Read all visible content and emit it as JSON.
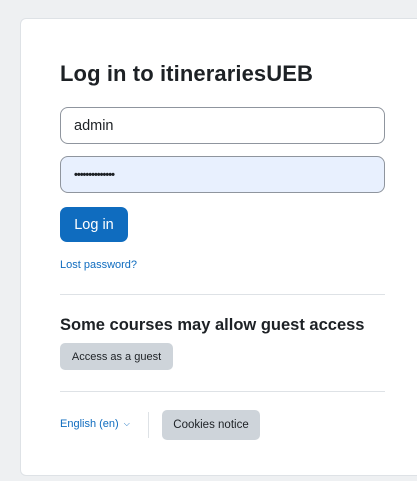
{
  "login": {
    "title": "Log in to itinerariesUEB",
    "username_value": "admin",
    "password_value": "••••••••••••••",
    "login_label": "Log in",
    "lost_password_label": "Lost password?"
  },
  "guest": {
    "heading": "Some courses may allow guest access",
    "button_label": "Access as a guest"
  },
  "footer": {
    "language_label": "English (en)",
    "language_chevron": "chevron-down-icon",
    "cookies_label": "Cookies notice"
  },
  "colors": {
    "primary": "#0f6cbf",
    "secondary_button": "#ced4da",
    "autofill_background": "#e8f0fe"
  }
}
